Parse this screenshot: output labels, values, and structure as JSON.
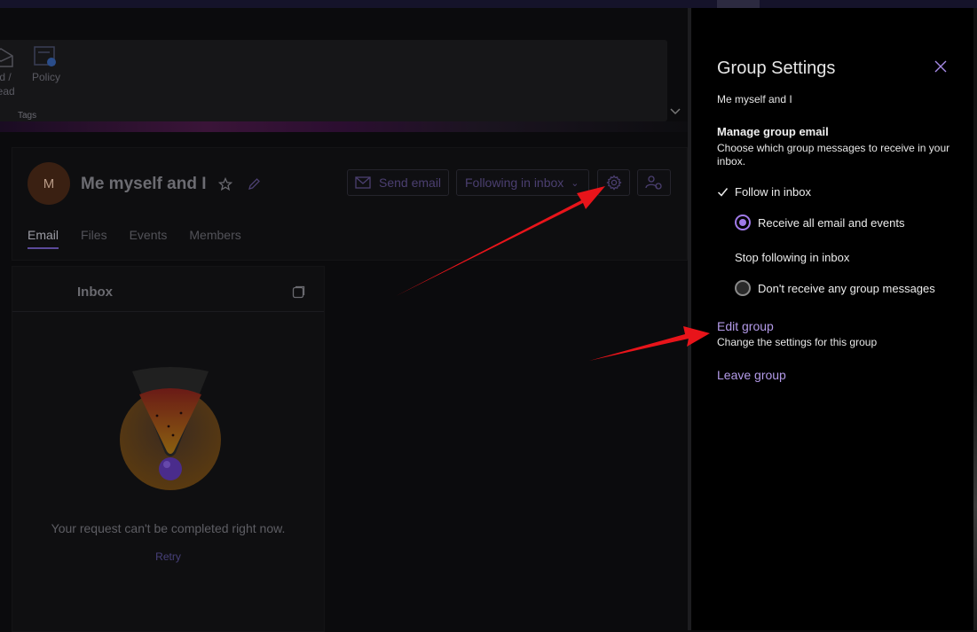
{
  "ribbon": {
    "read_label": "ead /",
    "read_label2": "nread",
    "policy_label": "Policy",
    "group_label": "Tags"
  },
  "group": {
    "avatar_initial": "M",
    "name": "Me myself and I",
    "send_email": "Send email",
    "following": "Following in inbox",
    "tabs": [
      "Email",
      "Files",
      "Events",
      "Members"
    ],
    "active_tab": "Email"
  },
  "inbox": {
    "title": "Inbox",
    "error": "Your request can't be completed right now.",
    "retry": "Retry"
  },
  "panel": {
    "title": "Group Settings",
    "group_name": "Me myself and I",
    "section_title": "Manage group email",
    "section_desc": "Choose which group messages to receive in your inbox.",
    "follow_label": "Follow in inbox",
    "receive_all": "Receive all email and events",
    "stop_following": "Stop following in inbox",
    "dont_receive": "Don't receive any group messages",
    "selected_option": "Receive all email and events",
    "edit_group": "Edit group",
    "edit_group_desc": "Change the settings for this group",
    "leave_group": "Leave group"
  },
  "colors": {
    "accent": "#a07ae8",
    "link": "#b39ae8",
    "annotation_arrow": "#e8141a"
  },
  "icons": [
    "star-icon",
    "edit-icon",
    "mail-icon",
    "gear-icon",
    "people-settings-icon",
    "popout-icon",
    "close-icon",
    "check-icon",
    "chevron-down-icon"
  ]
}
